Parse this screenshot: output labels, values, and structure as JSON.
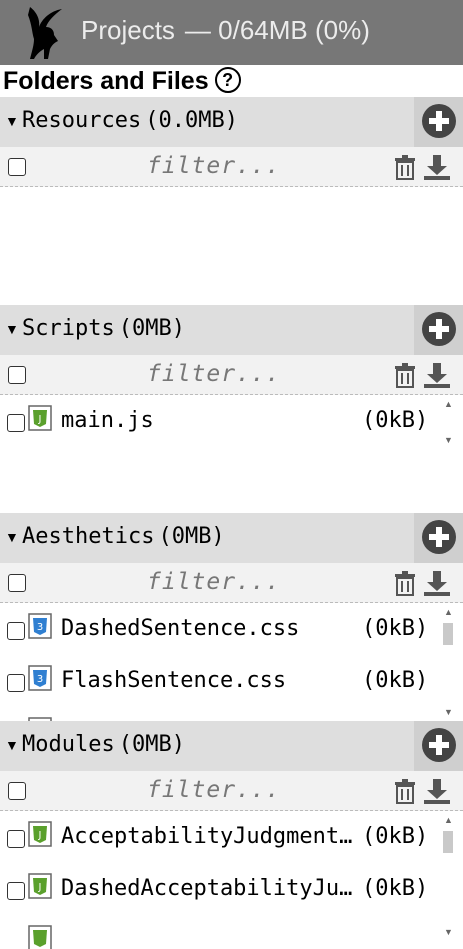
{
  "header": {
    "title": "Projects",
    "usage": "— 0/64MB (0%)"
  },
  "panel": {
    "heading": "Folders and Files",
    "help_label": "?"
  },
  "sections": [
    {
      "name": "Resources",
      "size": "(0.0MB)",
      "filter_placeholder": "filter...",
      "files": []
    },
    {
      "name": "Scripts",
      "size": "(0MB)",
      "filter_placeholder": "filter...",
      "files": [
        {
          "name": "main.js",
          "size": "(0kB)",
          "type": "js"
        }
      ]
    },
    {
      "name": "Aesthetics",
      "size": "(0MB)",
      "filter_placeholder": "filter...",
      "files": [
        {
          "name": "DashedSentence.css",
          "size": "(0kB)",
          "type": "css"
        },
        {
          "name": "FlashSentence.css",
          "size": "(0kB)",
          "type": "css"
        }
      ]
    },
    {
      "name": "Modules",
      "size": "(0MB)",
      "filter_placeholder": "filter...",
      "files": [
        {
          "name": "AcceptabilityJudgment.js",
          "size": "(0kB)",
          "type": "js"
        },
        {
          "name": "DashedAcceptabilityJudgment.js",
          "size": "(0kB)",
          "type": "js"
        }
      ]
    }
  ],
  "icons": {
    "js_color": "#5aa02c",
    "css_color": "#2f7fd1",
    "add_color": "#444444",
    "header_bg": "#777777",
    "section_bg": "#dedede"
  }
}
